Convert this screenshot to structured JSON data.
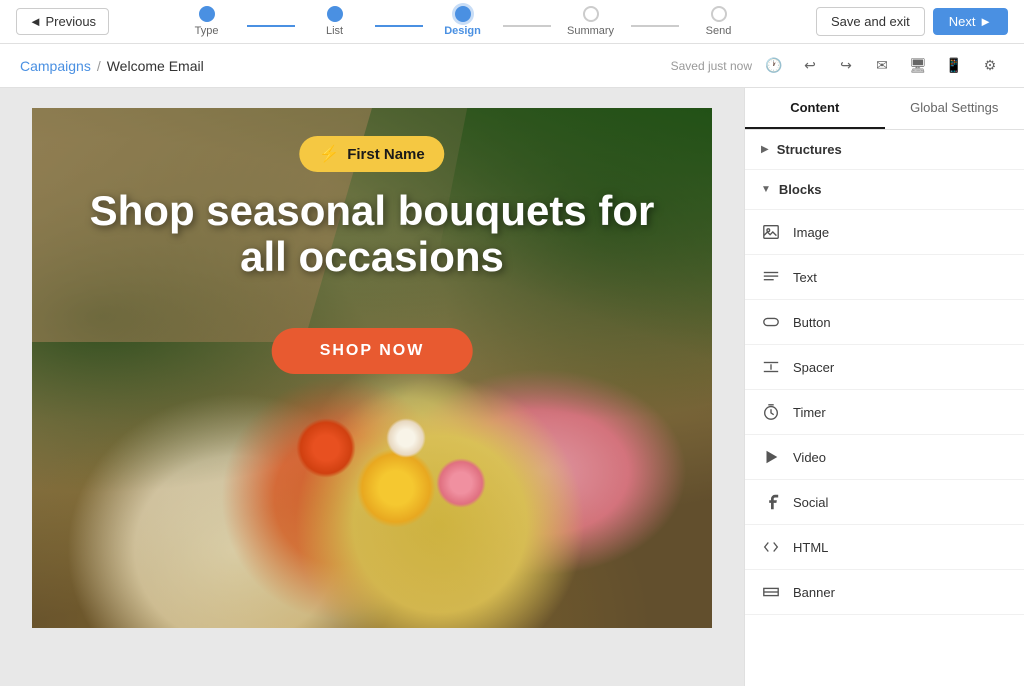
{
  "nav": {
    "previous_label": "◄ Previous",
    "next_label": "Next ►",
    "save_exit_label": "Save and exit",
    "steps": [
      {
        "id": "type",
        "label": "Type",
        "state": "completed"
      },
      {
        "id": "list",
        "label": "List",
        "state": "completed"
      },
      {
        "id": "design",
        "label": "Design",
        "state": "active"
      },
      {
        "id": "summary",
        "label": "Summary",
        "state": "inactive"
      },
      {
        "id": "send",
        "label": "Send",
        "state": "inactive"
      }
    ]
  },
  "breadcrumb": {
    "campaigns": "Campaigns",
    "separator": "/",
    "current": "Welcome Email",
    "saved_text": "Saved just now"
  },
  "canvas": {
    "badge_label": "First Name",
    "headline": "Shop seasonal bouquets for all occasions",
    "shop_button": "SHOP NOW"
  },
  "right_panel": {
    "tabs": [
      {
        "id": "content",
        "label": "Content",
        "active": true
      },
      {
        "id": "global_settings",
        "label": "Global Settings",
        "active": false
      }
    ],
    "structures_label": "Structures",
    "blocks_label": "Blocks",
    "blocks": [
      {
        "id": "image",
        "label": "Image",
        "icon": "image"
      },
      {
        "id": "text",
        "label": "Text",
        "icon": "text"
      },
      {
        "id": "button",
        "label": "Button",
        "icon": "button"
      },
      {
        "id": "spacer",
        "label": "Spacer",
        "icon": "spacer"
      },
      {
        "id": "timer",
        "label": "Timer",
        "icon": "timer"
      },
      {
        "id": "video",
        "label": "Video",
        "icon": "video"
      },
      {
        "id": "social",
        "label": "Social",
        "icon": "social"
      },
      {
        "id": "html",
        "label": "HTML",
        "icon": "html"
      },
      {
        "id": "banner",
        "label": "Banner",
        "icon": "banner"
      }
    ]
  },
  "colors": {
    "accent_blue": "#4a90e2",
    "shop_orange": "#e85a30",
    "badge_yellow": "#f5c842",
    "green_bg": "#2d5a27"
  }
}
